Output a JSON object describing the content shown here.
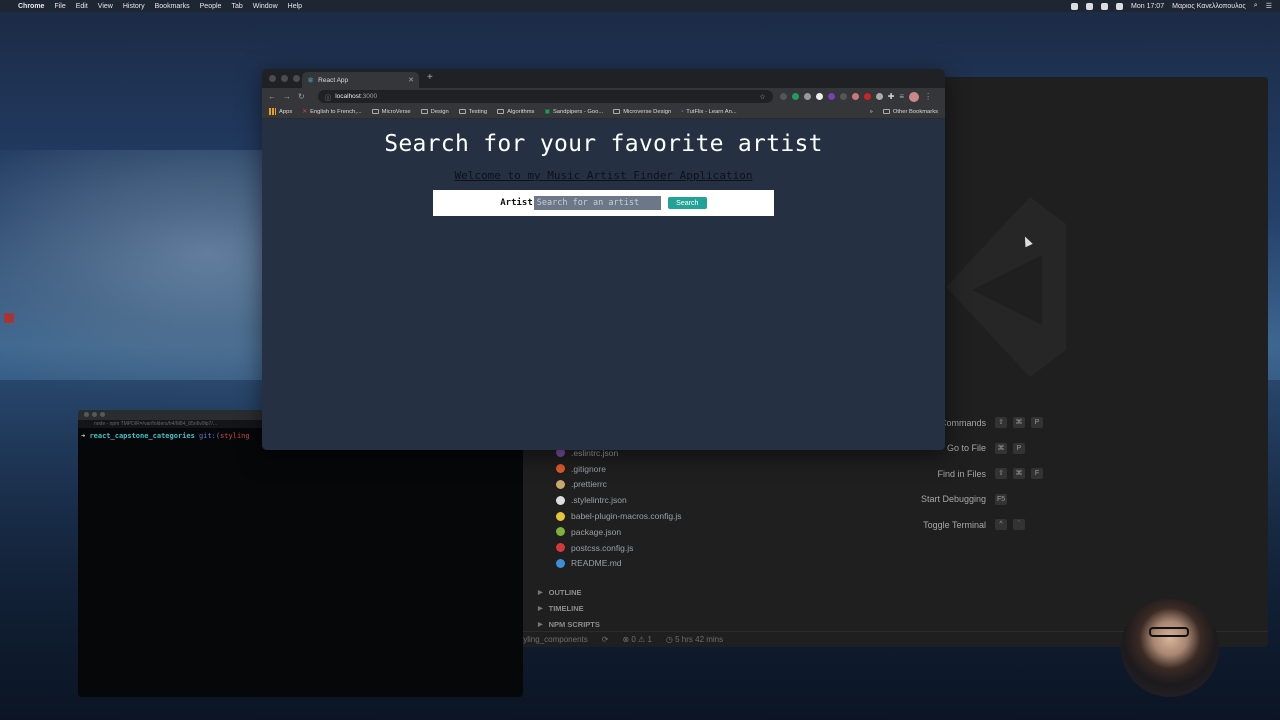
{
  "menubar": {
    "app": "Chrome",
    "items": [
      "File",
      "Edit",
      "View",
      "History",
      "Bookmarks",
      "People",
      "Tab",
      "Window",
      "Help"
    ],
    "clock": "Mon 17:07",
    "user": "Μαριος Κανελλοπουλος"
  },
  "chrome": {
    "tab_title": "React App",
    "url_host": "localhost",
    "url_port": ":3000",
    "bookmarks": [
      "Apps",
      "English to French,...",
      "MicroVerse",
      "Design",
      "Testing",
      "Algorithms",
      "Sandpipers - Goo...",
      "Microverse Design",
      "TutFlix - Learn An..."
    ],
    "other_bookmarks": "Other Bookmarks",
    "bookmarks_more": "»"
  },
  "page": {
    "title": "Search for your favorite artist",
    "subtitle": "Welcome to my Music Artist Finder Application",
    "search_label": "Artist",
    "search_placeholder": "Search for an artist",
    "search_button": "Search"
  },
  "terminal": {
    "title": "react_capstone_categories",
    "subtitle": "node - npm TMPDIR=/var/folders/h4/M84_85n6v9lp7/...",
    "prompt": "➜",
    "dir": "react_capstone_categories",
    "git": "git:(",
    "branch": "styling"
  },
  "vscode": {
    "shortcuts": [
      {
        "label": "Show All Commands",
        "keys": [
          "⇧",
          "⌘",
          "P"
        ]
      },
      {
        "label": "Go to File",
        "keys": [
          "⌘",
          "P"
        ]
      },
      {
        "label": "Find in Files",
        "keys": [
          "⇧",
          "⌘",
          "F"
        ]
      },
      {
        "label": "Start Debugging",
        "keys": [
          "F5"
        ]
      },
      {
        "label": "Toggle Terminal",
        "keys": [
          "^",
          "`"
        ]
      }
    ],
    "files": [
      {
        "name": ".eslintrc.json",
        "color": "#7d4fa8"
      },
      {
        "name": ".gitignore",
        "color": "#e05a2b"
      },
      {
        "name": ".prettierrc",
        "color": "#c9a86b"
      },
      {
        "name": ".stylelintrc.json",
        "color": "#dddddd"
      },
      {
        "name": "babel-plugin-macros.config.js",
        "color": "#e6c53a"
      },
      {
        "name": "package.json",
        "color": "#7fb13f"
      },
      {
        "name": "postcss.config.js",
        "color": "#d23a3a"
      },
      {
        "name": "README.md",
        "color": "#3b8fd8"
      }
    ],
    "sections": [
      "OUTLINE",
      "TIMELINE",
      "NPM SCRIPTS"
    ],
    "status": {
      "branch": "styling_components",
      "problems": "⊗ 0 ⚠ 1",
      "time": "5 hrs 42 mins"
    }
  }
}
